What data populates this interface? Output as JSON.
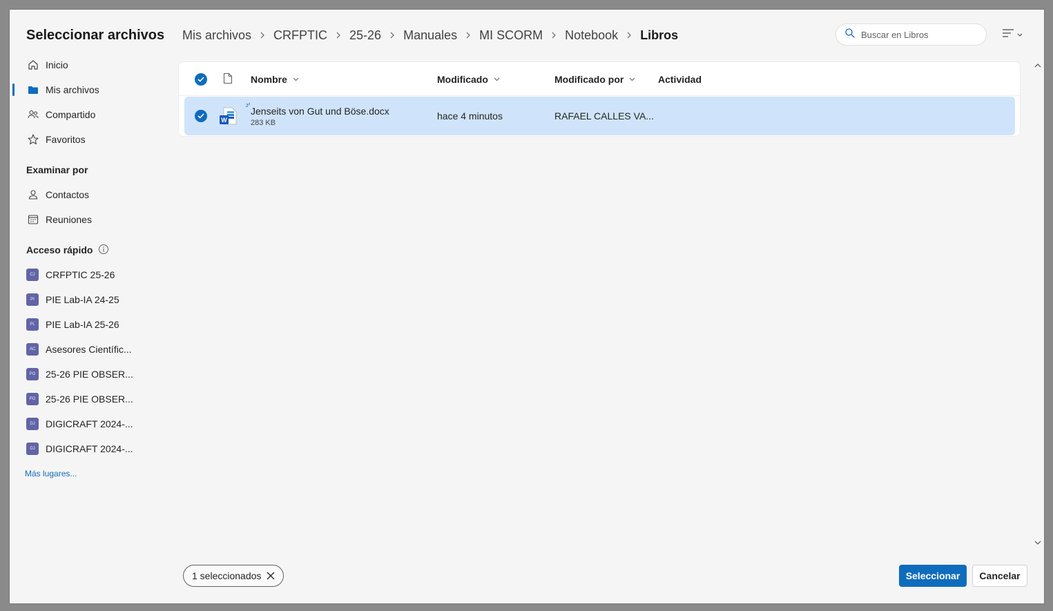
{
  "dialog": {
    "title": "Seleccionar archivos"
  },
  "sidebar": {
    "nav": [
      {
        "label": "Inicio",
        "icon": "home-icon"
      },
      {
        "label": "Mis archivos",
        "icon": "folder-icon",
        "active": true
      },
      {
        "label": "Compartido",
        "icon": "people-icon"
      },
      {
        "label": "Favoritos",
        "icon": "star-icon"
      }
    ],
    "browse_title": "Examinar por",
    "browse": [
      {
        "label": "Contactos",
        "icon": "person-icon"
      },
      {
        "label": "Reuniones",
        "icon": "calendar-icon"
      }
    ],
    "quick_title": "Acceso rápido",
    "quick": [
      {
        "label": "CRFPTIC 25-26",
        "badge": "CJ"
      },
      {
        "label": "PIE Lab-IA 24-25",
        "badge": "PI"
      },
      {
        "label": "PIE Lab-IA 25-26",
        "badge": "PL"
      },
      {
        "label": "Asesores Científic...",
        "badge": "AC"
      },
      {
        "label": "25-26 PIE OBSER...",
        "badge": "PO"
      },
      {
        "label": "25-26 PIE OBSER...",
        "badge": "PO"
      },
      {
        "label": "DIGICRAFT 2024-...",
        "badge": "DJ"
      },
      {
        "label": "DIGICRAFT 2024-...",
        "badge": "DJ"
      }
    ],
    "more_places": "Más lugares..."
  },
  "breadcrumb": [
    "Mis archivos",
    "CRFPTIC",
    "25-26",
    "Manuales",
    "MI SCORM",
    "Notebook",
    "Libros"
  ],
  "search": {
    "placeholder": "Buscar en Libros"
  },
  "table": {
    "columns": {
      "name": "Nombre",
      "modified": "Modificado",
      "modified_by": "Modificado por",
      "activity": "Actividad"
    },
    "rows": [
      {
        "name": "Jenseits von Gut und Böse.docx",
        "size": "283 KB",
        "modified": "hace 4 minutos",
        "modified_by": "RAFAEL CALLES VA...",
        "activity": ""
      }
    ]
  },
  "footer": {
    "selected_count": "1 seleccionados",
    "select_button": "Seleccionar",
    "cancel_button": "Cancelar"
  },
  "colors": {
    "accent": "#0f6cbd",
    "selected_row": "#cfe4fa",
    "team_badge": "#6264a7"
  }
}
